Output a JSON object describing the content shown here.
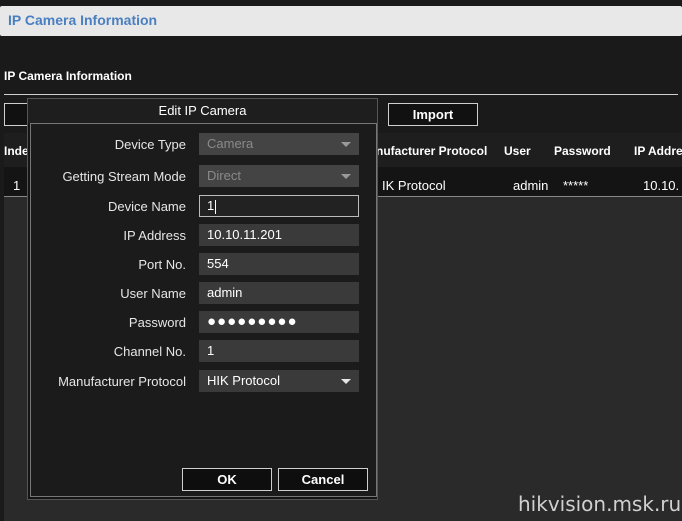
{
  "header": {
    "title": "IP Camera Information"
  },
  "section": {
    "title": "IP Camera Information"
  },
  "toolbar": {
    "import_label": "Import"
  },
  "table": {
    "columns": [
      "Inde",
      "nufacturer Protocol",
      "User",
      "Password",
      "IP Addre"
    ],
    "row": {
      "index": "1",
      "protocol": "IK Protocol",
      "user": "admin",
      "password": "*****",
      "ip": "10.10."
    }
  },
  "dialog": {
    "title": "Edit IP Camera",
    "fields": {
      "device_type": {
        "label": "Device Type",
        "value": "Camera"
      },
      "stream_mode": {
        "label": "Getting Stream Mode",
        "value": "Direct"
      },
      "device_name": {
        "label": "Device Name",
        "value": "1"
      },
      "ip_address": {
        "label": "IP Address",
        "value": "10.10.11.201"
      },
      "port": {
        "label": "Port No.",
        "value": "554"
      },
      "user_name": {
        "label": "User Name",
        "value": "admin"
      },
      "password": {
        "label": "Password",
        "value": "●●●●●●●●●"
      },
      "channel": {
        "label": "Channel No.",
        "value": "1"
      },
      "protocol": {
        "label": "Manufacturer Protocol",
        "value": "HIK Protocol"
      }
    },
    "ok_label": "OK",
    "cancel_label": "Cancel"
  },
  "watermark": "hikvision.msk.ru",
  "colors": {
    "header_title": "#4a7fc0",
    "background": "#1a1a1a"
  }
}
